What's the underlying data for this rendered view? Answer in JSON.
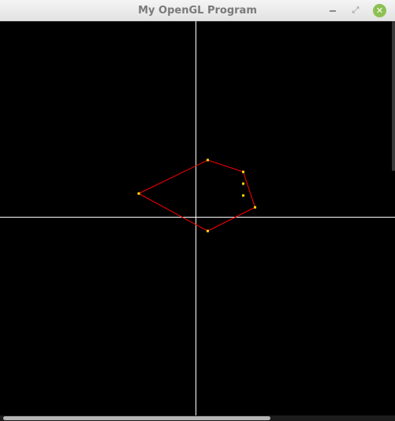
{
  "window": {
    "title": "My OpenGL Program",
    "controls": {
      "minimize_icon": "minimize-icon",
      "maximize_icon": "restore-icon",
      "close_icon": "close-icon",
      "close_glyph": "✕",
      "maximize_glyph": "⤢"
    }
  },
  "scene": {
    "background": "#000000",
    "axis_color": "#ffffff",
    "polygon_color": "#ff0000",
    "vertex_color": "#ffdd00",
    "polygon_vertices": [
      [
        -0.29,
        0.12
      ],
      [
        0.06,
        0.29
      ],
      [
        0.24,
        0.23
      ],
      [
        0.3,
        0.05
      ],
      [
        0.06,
        -0.07
      ]
    ],
    "extra_points": [
      [
        0.24,
        0.17
      ],
      [
        0.24,
        0.11
      ]
    ]
  },
  "scrollbars": {
    "horizontal_thumb_fraction": 0.68,
    "vertical_thumb_fraction": 0.38
  }
}
